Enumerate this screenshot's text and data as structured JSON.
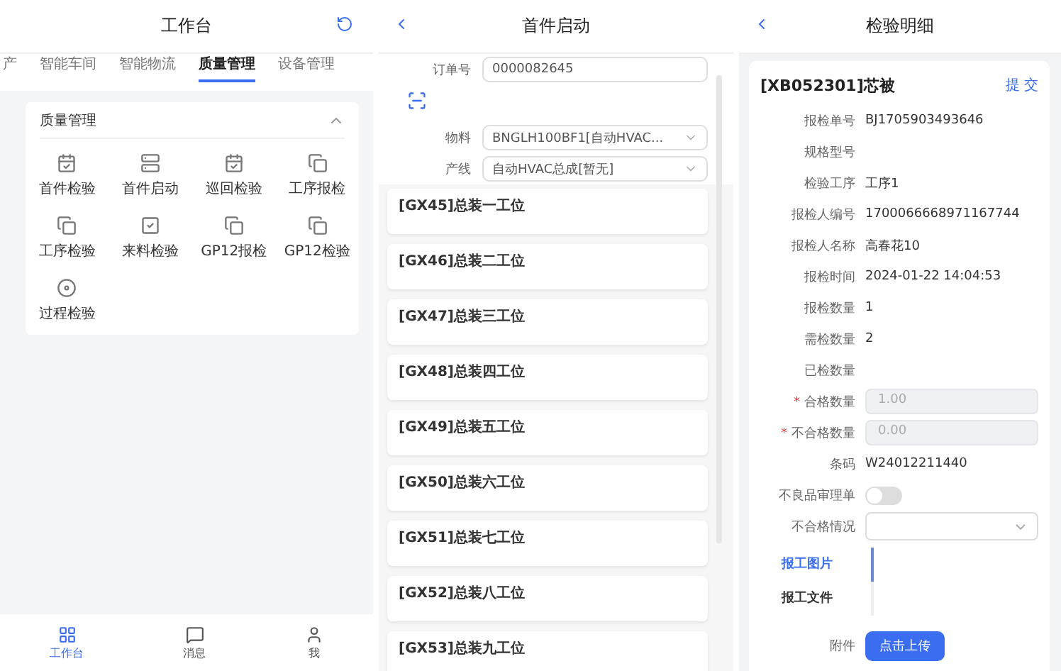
{
  "workbench": {
    "title": "工作台",
    "tabs": [
      {
        "label": "产",
        "selected": false
      },
      {
        "label": "智能车间",
        "selected": false
      },
      {
        "label": "智能物流",
        "selected": false
      },
      {
        "label": "质量管理",
        "selected": true
      },
      {
        "label": "设备管理",
        "selected": false
      }
    ],
    "section": {
      "title": "质量管理",
      "expanded": true,
      "items": [
        "首件检验",
        "首件启动",
        "巡回检验",
        "工序报检",
        "工序检验",
        "来料检验",
        "GP12报检",
        "GP12检验",
        "过程检验"
      ]
    },
    "bottom_nav": [
      {
        "label": "工作台",
        "selected": true
      },
      {
        "label": "消息",
        "selected": false
      },
      {
        "label": "我",
        "selected": false
      }
    ]
  },
  "first_piece": {
    "title": "首件启动",
    "fields": [
      {
        "label": "订单号",
        "value": "0000082645",
        "kind": "input"
      },
      {
        "label": "物料",
        "value": "BNGLH100BF1[自动HVAC...",
        "kind": "select"
      },
      {
        "label": "产线",
        "value": "自动HVAC总成[暂无]",
        "kind": "select"
      }
    ],
    "stations": [
      "[GX45]总装一工位",
      "[GX46]总装二工位",
      "[GX47]总装三工位",
      "[GX48]总装四工位",
      "[GX49]总装五工位",
      "[GX50]总装六工位",
      "[GX51]总装七工位",
      "[GX52]总装八工位",
      "[GX53]总装九工位"
    ]
  },
  "detail": {
    "title": "检验明细",
    "card_title": "[XB052301]芯被",
    "submit": "提 交",
    "rows": [
      {
        "label": "报检单号",
        "kind": "text",
        "value": "BJ1705903493646"
      },
      {
        "label": "规格型号",
        "kind": "text"
      },
      {
        "label": "检验工序",
        "kind": "text",
        "value": "工序1"
      },
      {
        "label": "报检人编号",
        "kind": "text",
        "value": "1700066668971167744"
      },
      {
        "label": "报检人名称",
        "kind": "text",
        "value": "高春花10"
      },
      {
        "label": "报检时间",
        "kind": "text",
        "value": "2024-01-22 14:04:53"
      },
      {
        "label": "报检数量",
        "kind": "text",
        "value": "1"
      },
      {
        "label": "需检数量",
        "kind": "text",
        "value": "2"
      },
      {
        "label": "已检数量",
        "kind": "text"
      },
      {
        "label": "合格数量",
        "kind": "input",
        "required": "*",
        "placeholder": "1.00"
      },
      {
        "label": "不合格数量",
        "kind": "input",
        "required": "*",
        "placeholder": "0.00"
      },
      {
        "label": "条码",
        "kind": "text",
        "value": "W24012211440"
      },
      {
        "label": "不良品审理单",
        "kind": "switch",
        "on": false
      },
      {
        "label": "不合格情况",
        "kind": "select"
      }
    ],
    "side_tabs": [
      {
        "label": "报工图片",
        "selected": true
      },
      {
        "label": "报工文件",
        "selected": false
      }
    ],
    "attachment": {
      "label": "附件",
      "button": "点击上传"
    }
  }
}
